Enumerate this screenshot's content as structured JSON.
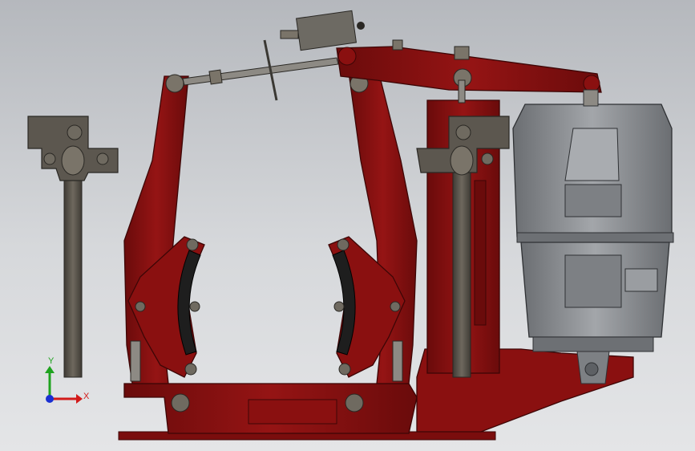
{
  "viewport": {
    "background_top": "#b5b8bd",
    "background_bottom": "#e4e5e7"
  },
  "model": {
    "frame_color": "#8a1010",
    "frame_dark": "#5e0a0a",
    "metal_color": "#5f5a52",
    "metal_dark": "#3d3a35",
    "pad_color": "#1e1e1e",
    "motor_color": "#8f9296",
    "motor_dark": "#5d6064"
  },
  "triad": {
    "x_label": "X",
    "y_label": "Y",
    "x_color": "#d21a1a",
    "y_color": "#1fa31f",
    "z_color": "#1a2fd2"
  }
}
